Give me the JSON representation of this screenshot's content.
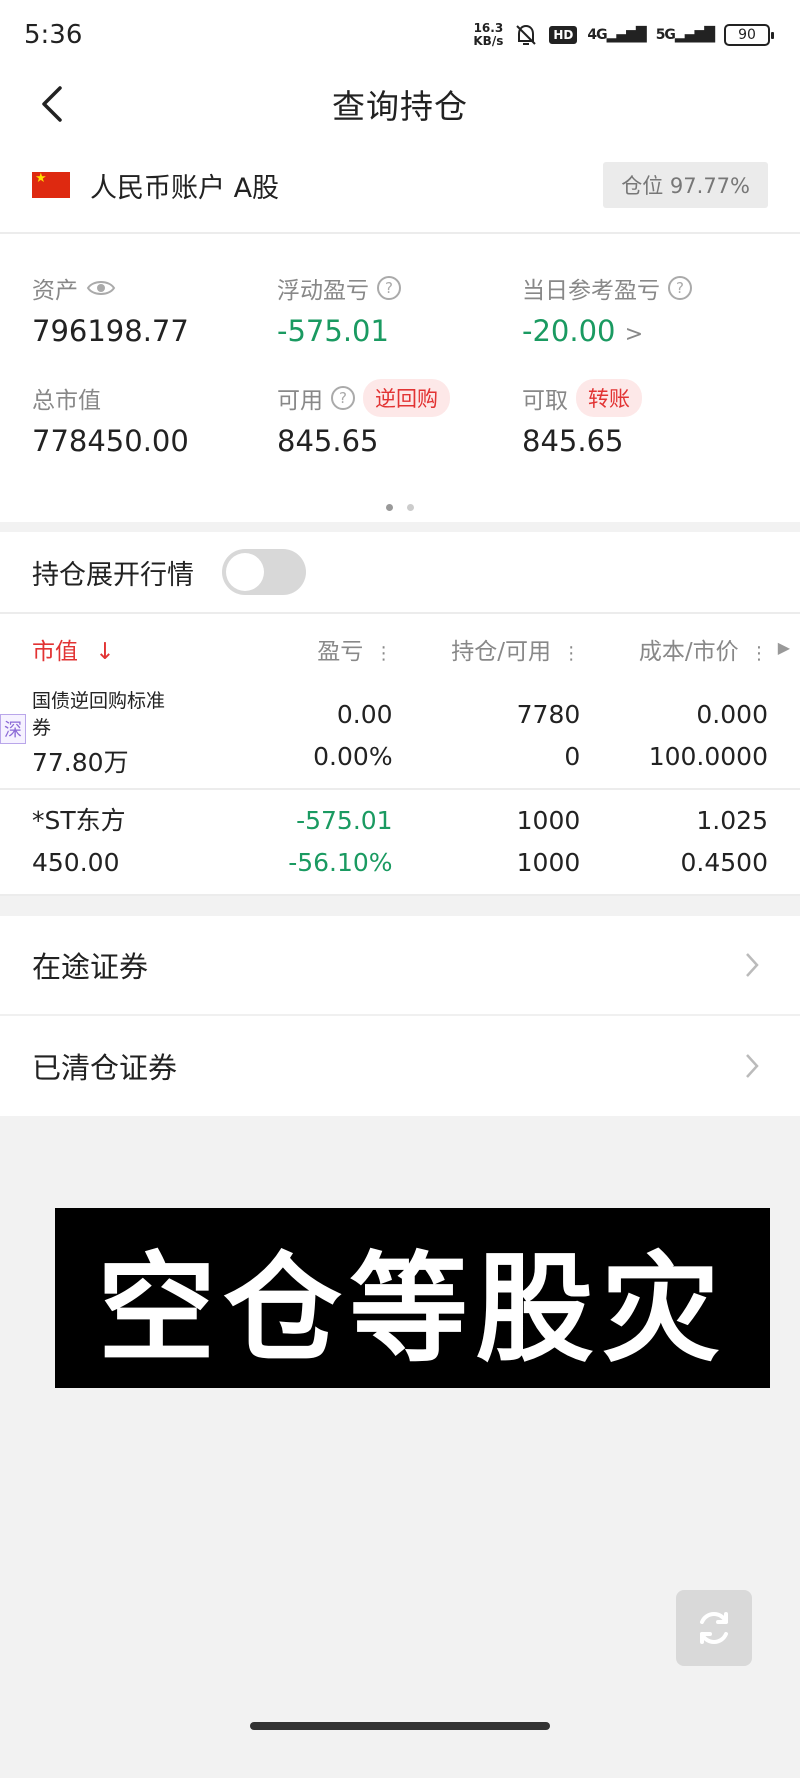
{
  "status_bar": {
    "time": "5:36",
    "net_speed_value": "16.3",
    "net_speed_unit": "KB/s",
    "signal_1": "4G",
    "signal_2": "5G",
    "hd_badge": "HD",
    "battery": "90"
  },
  "nav": {
    "title": "查询持仓"
  },
  "account": {
    "name": "人民币账户 A股",
    "position_ratio": "仓位 97.77%"
  },
  "stats": {
    "assets_label": "资产",
    "assets_value": "796198.77",
    "float_pl_label": "浮动盈亏",
    "float_pl_value": "-575.01",
    "daily_pl_label": "当日参考盈亏",
    "daily_pl_value": "-20.00",
    "daily_pl_arrow": ">",
    "market_value_label": "总市值",
    "market_value_value": "778450.00",
    "available_label": "可用",
    "available_value": "845.65",
    "reverse_repo_button": "逆回购",
    "withdrawable_label": "可取",
    "withdrawable_value": "845.65",
    "transfer_button": "转账"
  },
  "expand": {
    "label": "持仓展开行情",
    "toggle_on": false
  },
  "table": {
    "headers": {
      "market_value": "市值",
      "sort_arrow": "↓",
      "pl": "盈亏",
      "holding": "持仓/可用",
      "cost": "成本/市价"
    },
    "rows": [
      {
        "market_tag": "深",
        "name": "国债逆回购标准券",
        "market_value": "77.80万",
        "pl_amount": "0.00",
        "pl_percent": "0.00%",
        "holding": "7780",
        "available": "0",
        "cost": "0.000",
        "price": "100.0000"
      },
      {
        "name": "*ST东方",
        "market_value": "450.00",
        "pl_amount": "-575.01",
        "pl_percent": "-56.10%",
        "holding": "1000",
        "available": "1000",
        "cost": "1.025",
        "price": "0.4500"
      }
    ]
  },
  "menu": {
    "in_transit": "在途证券",
    "cleared": "已清仓证券"
  },
  "banner": {
    "text": "空仓等股灾"
  },
  "colors": {
    "loss_green": "#1a9a61",
    "accent_red": "#e23333"
  }
}
